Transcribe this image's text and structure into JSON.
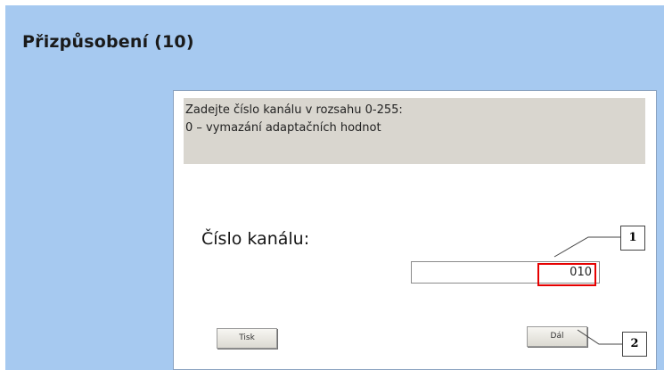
{
  "window": {
    "title": "Přizpůsobení (10)"
  },
  "info_panel": {
    "line1": "Zadejte číslo kanálu v rozsahu 0-255:",
    "line2": "0 – vymazání adaptačních hodnot"
  },
  "channel": {
    "label": "Číslo kanálu:",
    "value": "010"
  },
  "buttons": {
    "left_label": "Tisk",
    "right_label": "Dál"
  },
  "callouts": {
    "one": "1",
    "two": "2"
  },
  "colors": {
    "background": "#a6c9f0",
    "panel": "#ffffff",
    "info_panel": "#d9d6cf",
    "callout_highlight": "#e60000"
  }
}
